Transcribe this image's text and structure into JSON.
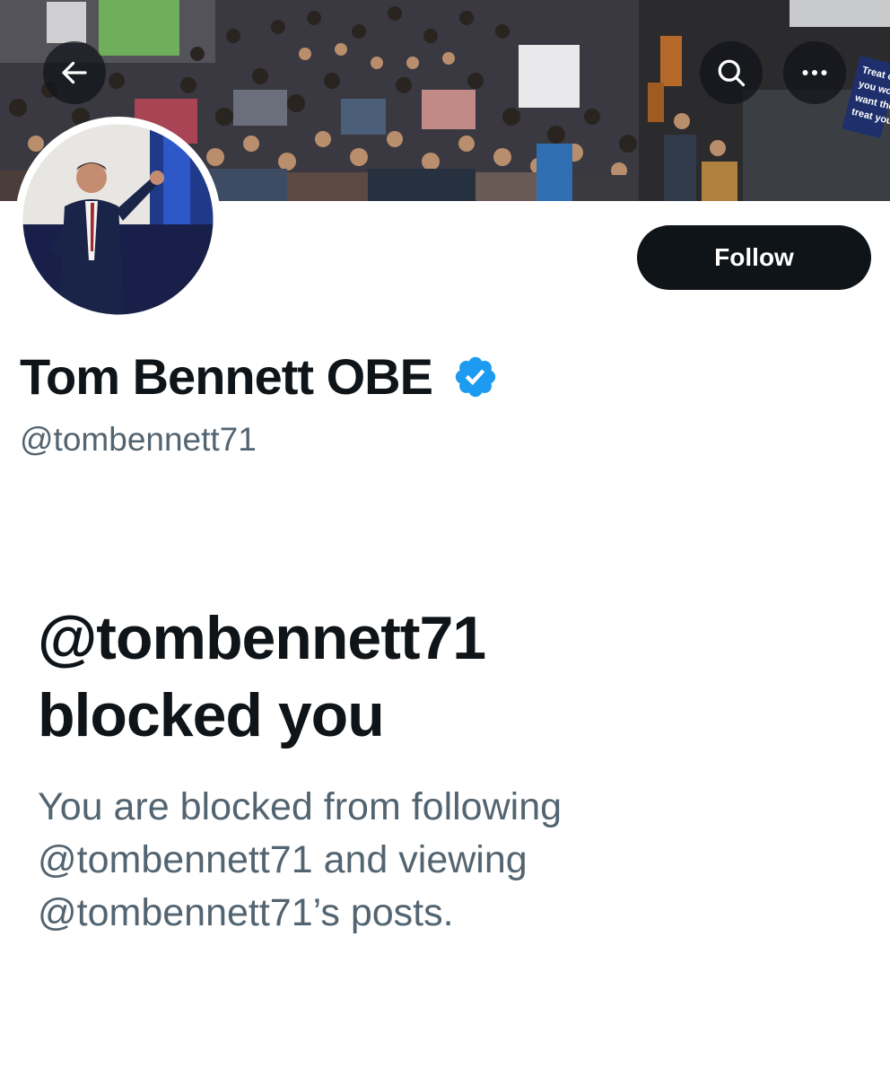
{
  "banner": {
    "sign_text": [
      "Treat others",
      "you would",
      "want them to",
      "treat you"
    ]
  },
  "nav": {
    "back_icon": "arrow-left-icon",
    "search_icon": "search-icon",
    "more_icon": "more-horizontal-icon"
  },
  "profile": {
    "follow_label": "Follow",
    "display_name": "Tom Bennett OBE",
    "verified_icon": "verified-badge-icon",
    "verified_color": "#1d9bf0",
    "handle": "@tombennett71"
  },
  "blocked": {
    "title_line1": "@tombennett71",
    "title_line2": "blocked you",
    "desc_line1": "You are blocked from following",
    "desc_line2": "@tombennett71 and viewing",
    "desc_line3": "@tombennett71’s posts."
  }
}
